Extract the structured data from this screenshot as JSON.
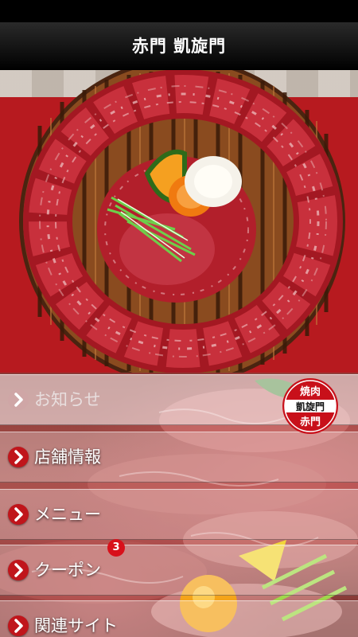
{
  "app": {
    "title": "赤門 凱旋門"
  },
  "logo": {
    "line1": "焼肉",
    "line2": "凱旋門",
    "line3": "赤門"
  },
  "menu": {
    "items": [
      {
        "label": "お知らせ",
        "icon": "chevron-right-icon"
      },
      {
        "label": "店舗情報",
        "icon": "chevron-right-icon"
      },
      {
        "label": "メニュー",
        "icon": "chevron-right-icon"
      },
      {
        "label": "クーポン",
        "icon": "chevron-right-icon",
        "badge": "3"
      },
      {
        "label": "関連サイト",
        "icon": "chevron-right-icon"
      }
    ]
  },
  "colors": {
    "accent": "#c0151b",
    "hero_bg": "#b71a1f",
    "badge": "#d8101a"
  }
}
